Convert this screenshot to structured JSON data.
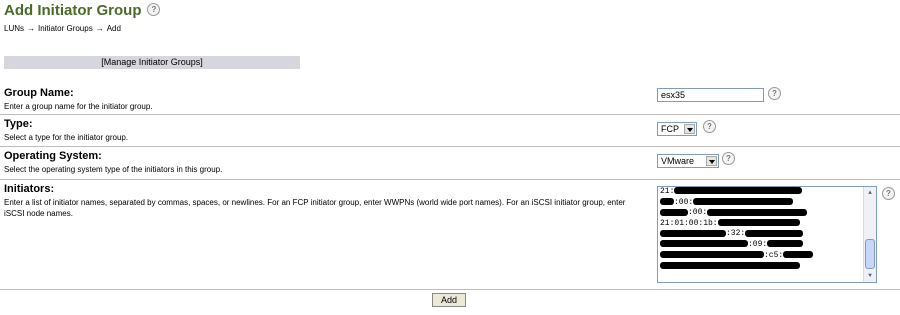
{
  "page": {
    "title": "Add Initiator Group",
    "help_glyph": "?",
    "breadcrumb": [
      "LUNs",
      "Initiator Groups",
      "Add"
    ],
    "breadcrumb_separator": "→"
  },
  "manage_link": "[Manage Initiator Groups]",
  "form": {
    "group_name": {
      "label": "Group Name:",
      "description": "Enter a group name for the initiator group.",
      "value": "esx35"
    },
    "type": {
      "label": "Type:",
      "description": "Select a type for the initiator group.",
      "selected": "FCP"
    },
    "os": {
      "label": "Operating System:",
      "description": "Select the operating system type of the initiators in this group.",
      "selected": "VMware"
    },
    "initiators": {
      "label": "Initiators:",
      "description": "Enter a list of initiator names, separated by commas, spaces, or newlines. For an FCP initiator group, enter WWPNs (world wide port names). For an iSCSI initiator group, enter iSCSI node names.",
      "lines": [
        "21:",
        ":00:",
        ":00:",
        "21:01:00:1b:",
        ":32:",
        ":09:",
        ":c5:",
        ""
      ]
    }
  },
  "add_button": "Add",
  "icons": {
    "help": "help-icon",
    "dropdown": "chevron-down-icon",
    "scroll_up": "arrow-up-icon",
    "scroll_down": "arrow-down-icon"
  }
}
